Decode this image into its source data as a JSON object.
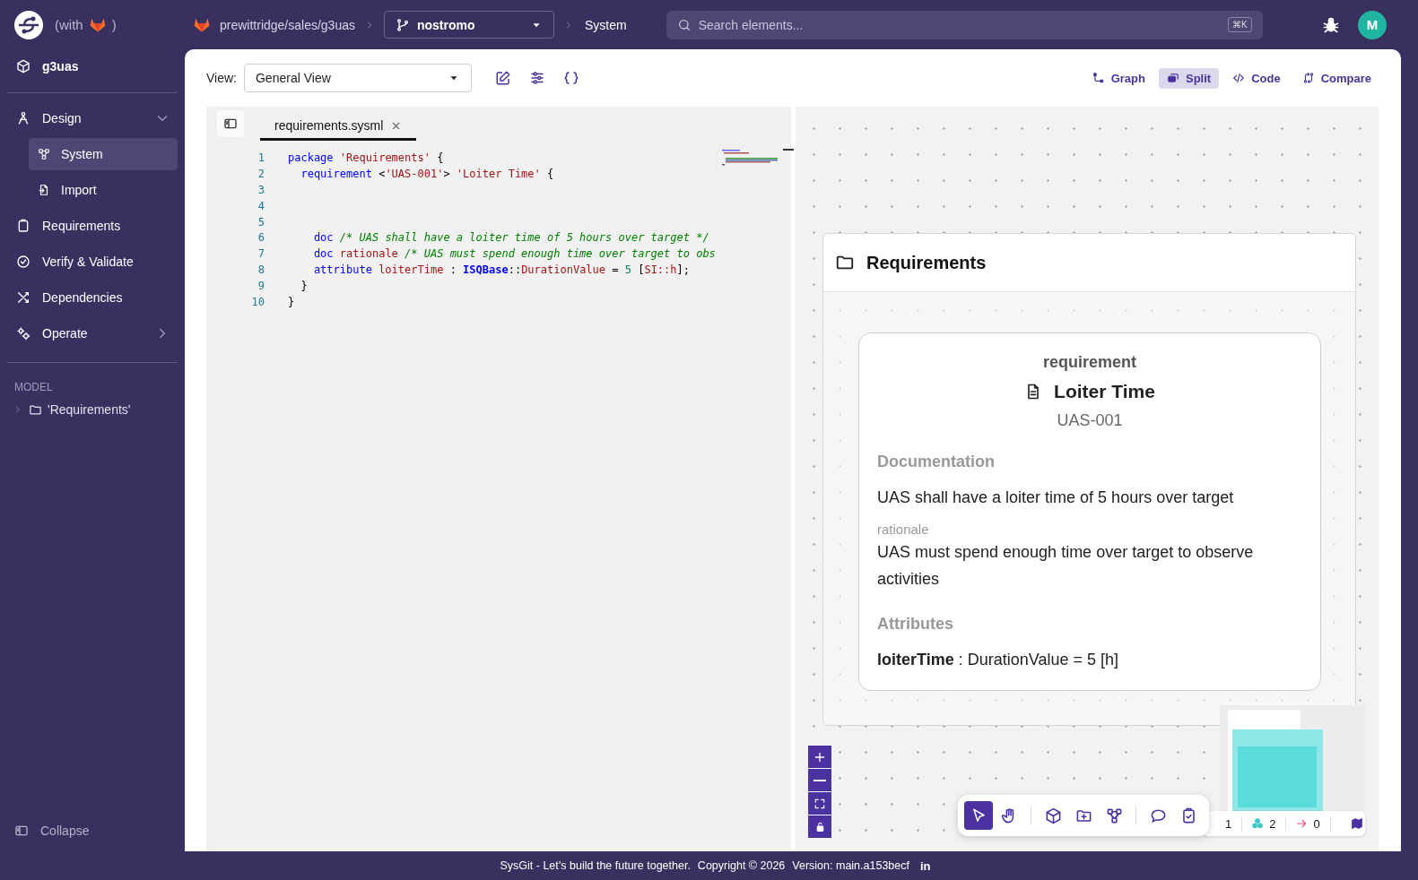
{
  "app": {
    "with_text": "(with",
    "with_close": ")"
  },
  "topbar": {
    "repo": "prewittridge/sales/g3uas",
    "branch": "nostromo",
    "page": "System",
    "search": {
      "placeholder": "Search elements...",
      "shortcut": "⌘K"
    },
    "avatar": "M"
  },
  "sidebar": {
    "project": "g3uas",
    "items": [
      {
        "label": "Design",
        "selected": false,
        "expanded": true,
        "children": [
          {
            "label": "System",
            "selected": true
          },
          {
            "label": "Import",
            "selected": false
          }
        ]
      },
      {
        "label": "Requirements",
        "selected": false
      },
      {
        "label": "Verify & Validate",
        "selected": false
      },
      {
        "label": "Dependencies",
        "selected": false
      },
      {
        "label": "Operate",
        "selected": false,
        "expanded": false
      }
    ],
    "model": {
      "heading": "MODEL",
      "tree": [
        {
          "label": "'Requirements'",
          "expanded": false
        }
      ]
    },
    "collapse": "Collapse"
  },
  "toolbar": {
    "view_label": "View:",
    "view_value": "General View",
    "modes": [
      {
        "label": "Graph",
        "selected": false
      },
      {
        "label": "Split",
        "selected": true
      },
      {
        "label": "Code",
        "selected": false
      },
      {
        "label": "Compare",
        "selected": false
      }
    ]
  },
  "editor": {
    "tabs": [
      {
        "label": "requirements.sysml",
        "selected": true
      }
    ],
    "lines": [
      {
        "number": "1",
        "tokens": [
          {
            "kind": "keyword",
            "text": "package"
          },
          {
            "kind": "string",
            "text": " 'Requirements'"
          },
          {
            "kind": "plain",
            "text": " {"
          }
        ]
      },
      {
        "number": "2",
        "tokens": [
          {
            "kind": "keyword",
            "text": "  requirement"
          },
          {
            "kind": "plain",
            "text": " <"
          },
          {
            "kind": "string",
            "text": "'UAS-001'"
          },
          {
            "kind": "plain",
            "text": "> "
          },
          {
            "kind": "string",
            "text": "'Loiter Time'"
          },
          {
            "kind": "plain",
            "text": " {"
          }
        ]
      },
      {
        "number": "3"
      },
      {
        "number": "4"
      },
      {
        "number": "5"
      },
      {
        "number": "6",
        "tokens": [
          {
            "kind": "keyword",
            "text": "    doc"
          },
          {
            "kind": "comment",
            "text": " /* UAS shall have a loiter time of 5 hours over target */"
          }
        ]
      },
      {
        "number": "7",
        "tokens": [
          {
            "kind": "keyword",
            "text": "    doc"
          },
          {
            "kind": "name",
            "text": " rationale"
          },
          {
            "kind": "comment",
            "text": " /* UAS must spend enough time over target to obs"
          }
        ]
      },
      {
        "number": "8",
        "tokens": [
          {
            "kind": "keyword",
            "text": "    attribute"
          },
          {
            "kind": "name",
            "text": " loiterTime"
          },
          {
            "kind": "plain",
            "text": " : "
          },
          {
            "kind": "type",
            "text": "ISQBase"
          },
          {
            "kind": "plain",
            "text": "::"
          },
          {
            "kind": "name",
            "text": "DurationValue"
          },
          {
            "kind": "plain",
            "text": " = "
          },
          {
            "kind": "number",
            "text": "5"
          },
          {
            "kind": "plain",
            "text": " ["
          },
          {
            "kind": "name",
            "text": "SI::h"
          },
          {
            "kind": "plain",
            "text": "];"
          }
        ]
      },
      {
        "number": "9",
        "tokens": [
          {
            "kind": "plain",
            "text": "  }"
          }
        ]
      },
      {
        "number": "10",
        "tokens": [
          {
            "kind": "plain",
            "text": "}"
          }
        ]
      }
    ]
  },
  "diagram": {
    "package": {
      "title": "Requirements",
      "element": {
        "kind_label": "requirement",
        "title": "Loiter Time",
        "id": "UAS-001",
        "documentation_heading": "Documentation",
        "documentation": "UAS shall have a loiter time of 5 hours over target",
        "rationale_label": "rationale",
        "rationale": "UAS must spend enough time over target to observe activities",
        "attributes_heading": "Attributes",
        "attributes": [
          "**loiterTime** : DurationValue = 5 [h]"
        ]
      }
    },
    "tool_groups": [
      {
        "tools": [
          {
            "selected": true
          },
          {
            "selected": false
          }
        ]
      },
      {
        "tools": [
          {
            "selected": false
          },
          {
            "selected": false
          },
          {
            "selected": false
          }
        ]
      },
      {
        "tools": [
          {
            "selected": false
          },
          {
            "selected": false
          }
        ]
      }
    ],
    "stats": [
      {
        "kind": "plain",
        "value": "1"
      },
      {
        "kind": "cluster",
        "value": "2"
      },
      {
        "kind": "arrow",
        "value": "0"
      }
    ]
  },
  "footer": {
    "tagline": "SysGit - Let’s build the future together.",
    "copyright": "Copyright © 2026",
    "version": "Version: main.a153becf",
    "social": "in"
  }
}
